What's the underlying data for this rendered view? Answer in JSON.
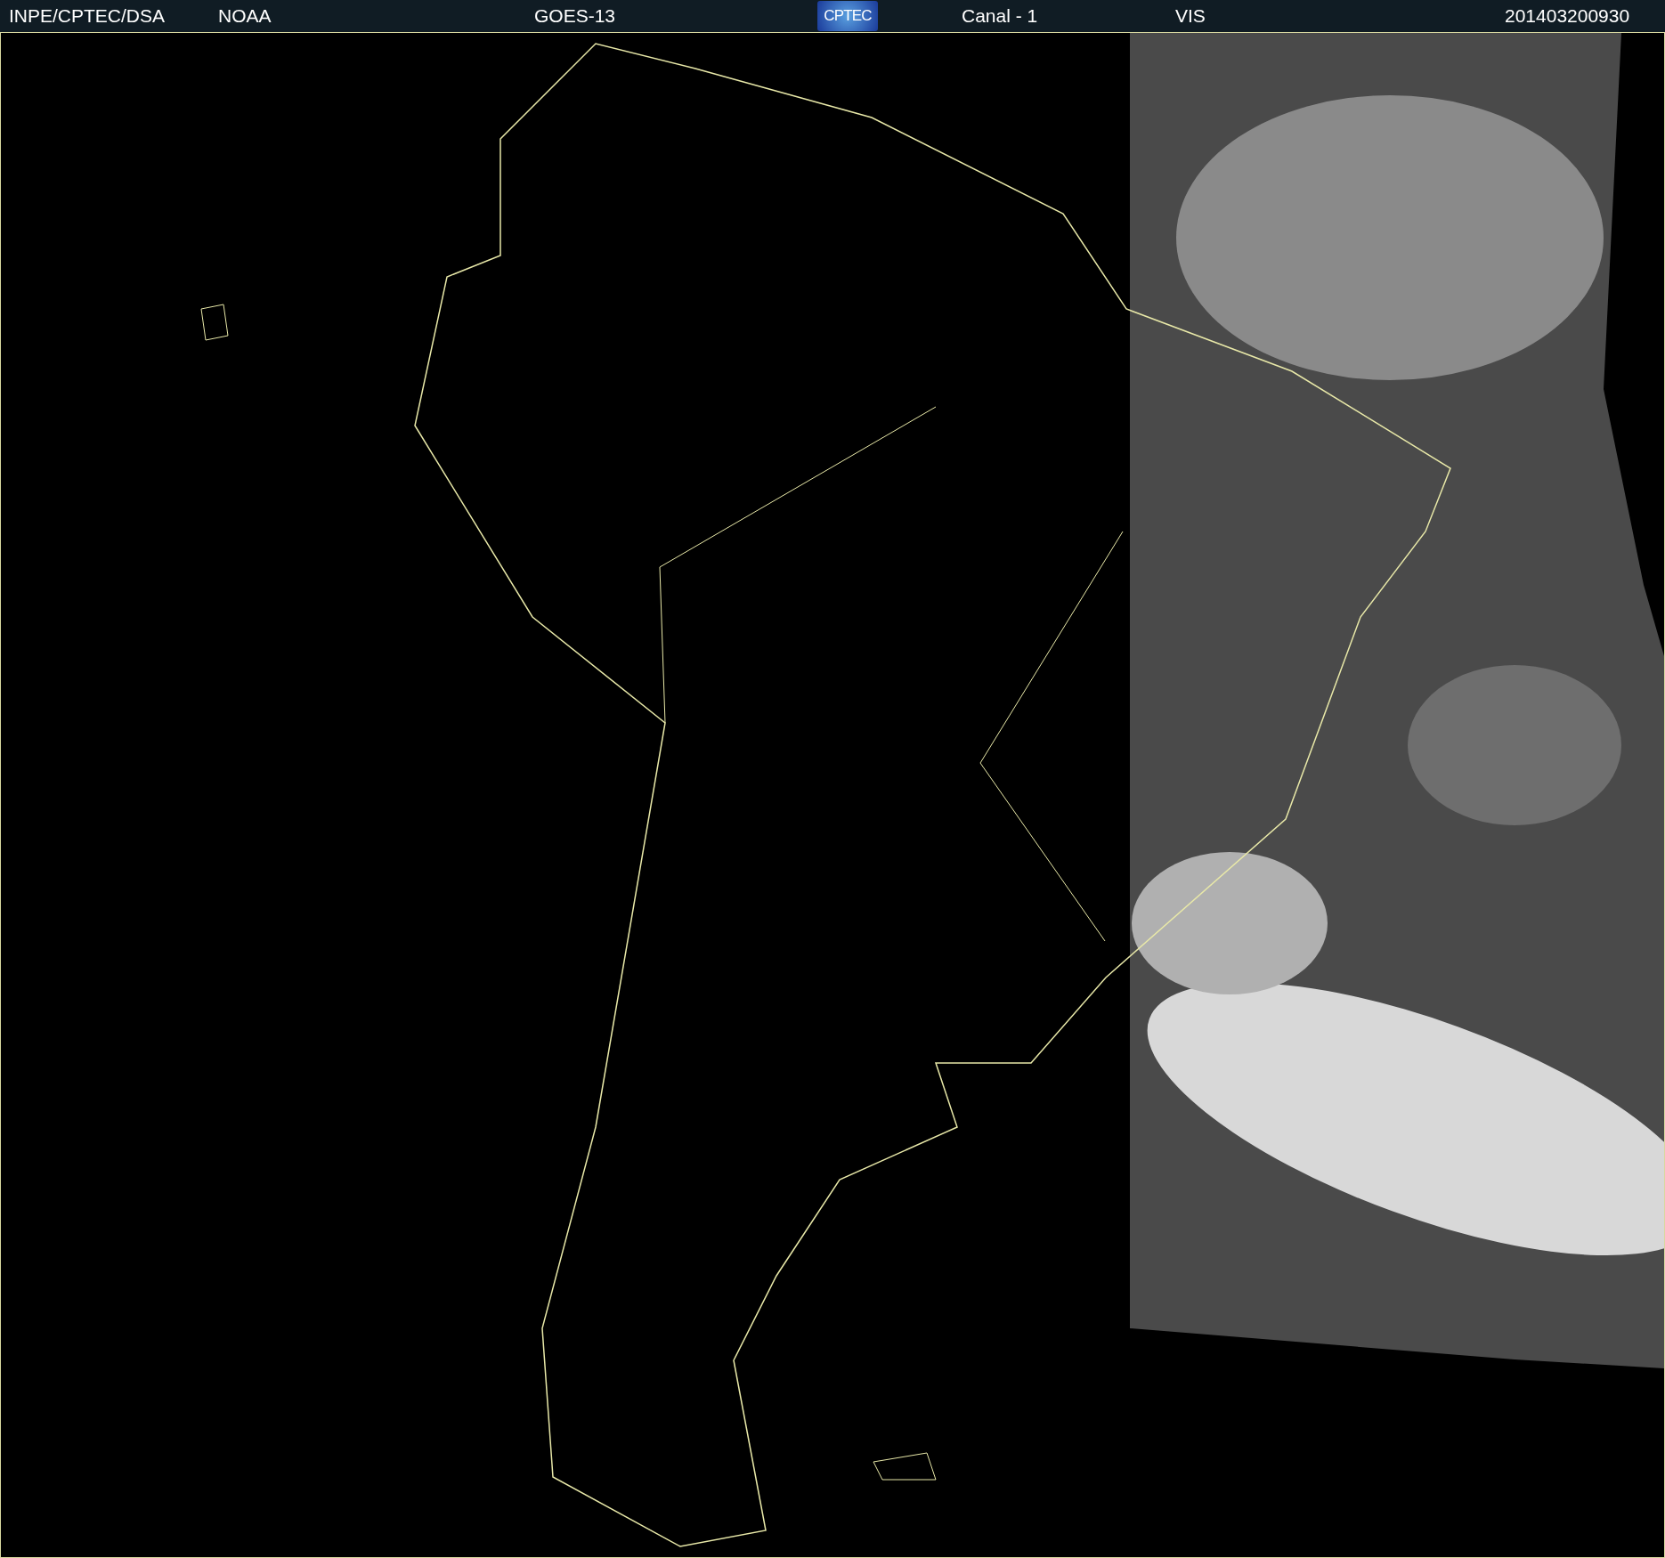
{
  "header": [
    {
      "kind": "text",
      "label": "INPE/CPTEC/DSA"
    },
    {
      "kind": "text",
      "label": "NOAA"
    },
    {
      "kind": "text",
      "label": "GOES-13"
    },
    {
      "kind": "logo",
      "label": "CPTEC"
    },
    {
      "kind": "text",
      "label": "Canal - 1"
    },
    {
      "kind": "text",
      "label": "VIS"
    },
    {
      "kind": "text",
      "label": "201403200930"
    }
  ]
}
